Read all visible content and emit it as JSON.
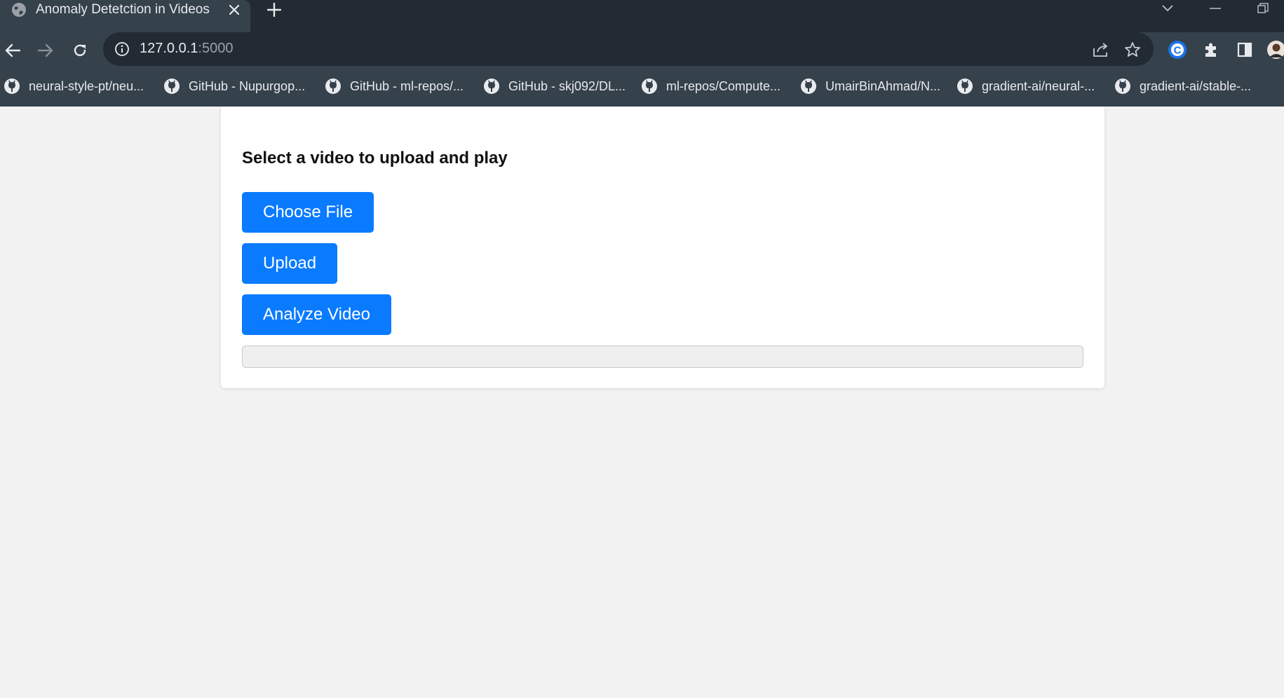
{
  "browser": {
    "tab": {
      "title": "Anomaly Detetction in Videos"
    },
    "address_bar": {
      "host": "127.0.0.1",
      "port": ":5000"
    },
    "bookmarks": [
      {
        "label": "neural-style-pt/neu..."
      },
      {
        "label": "GitHub - Nupurgop..."
      },
      {
        "label": "GitHub - ml-repos/..."
      },
      {
        "label": "GitHub - skj092/DL..."
      },
      {
        "label": "ml-repos/Compute..."
      },
      {
        "label": "UmairBinAhmad/N..."
      },
      {
        "label": "gradient-ai/neural-..."
      },
      {
        "label": "gradient-ai/stable-..."
      }
    ],
    "colors": {
      "frame": "#222b33",
      "toolbar": "#35414b",
      "text": "#e8eaed"
    }
  },
  "page": {
    "heading": "Select a video to upload and play",
    "buttons": {
      "choose_file": "Choose File",
      "upload": "Upload",
      "analyze": "Analyze Video"
    },
    "progress": {
      "value": 0
    },
    "colors": {
      "button": "#0a7bff",
      "background": "#f2f2f2",
      "card": "#ffffff"
    }
  }
}
